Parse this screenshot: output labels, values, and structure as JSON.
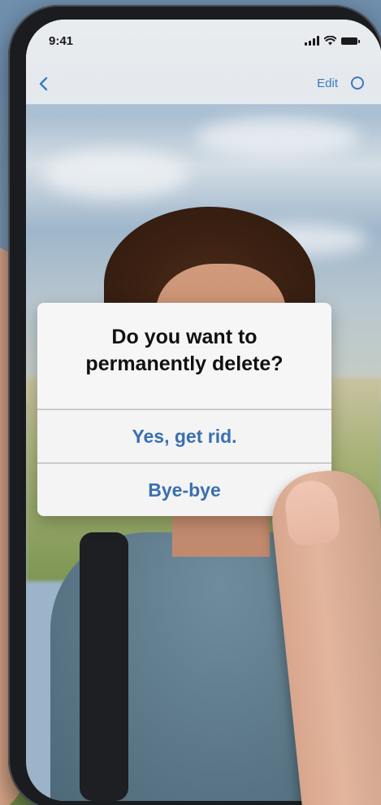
{
  "status_bar": {
    "time": "9:41"
  },
  "nav_bar": {
    "back_icon": "chevron-left-icon",
    "edit_label": "Edit",
    "more_icon": "circle-icon"
  },
  "alert": {
    "title_line1": "Do you want to",
    "title_line2": "permanently delete?",
    "yes_label": "Yes, get rid.",
    "bye_label": "Bye-bye"
  },
  "colors": {
    "accent": "#3a78c4",
    "alert_button_text": "#3a6fb0",
    "alert_background": "#f6f6f7"
  }
}
